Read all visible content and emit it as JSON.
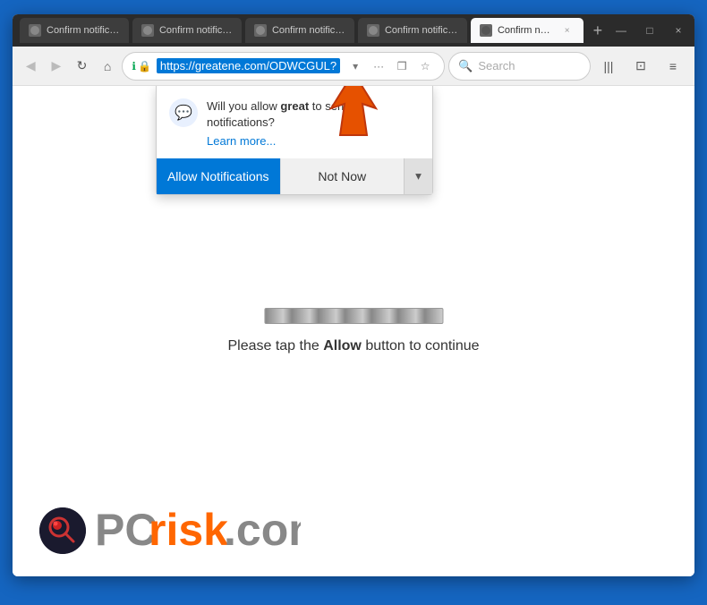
{
  "browser": {
    "tabs": [
      {
        "id": 1,
        "label": "Confirm notificatio...",
        "active": false
      },
      {
        "id": 2,
        "label": "Confirm notificatio...",
        "active": false
      },
      {
        "id": 3,
        "label": "Confirm notificatio...",
        "active": false
      },
      {
        "id": 4,
        "label": "Confirm notificatio...",
        "active": false
      },
      {
        "id": 5,
        "label": "Confirm notific...",
        "active": true
      }
    ],
    "url": "https://greatene.com/ODWCGUL?",
    "search_placeholder": "Search"
  },
  "notification_popup": {
    "message_prefix": "Will you allow ",
    "site": "great",
    "message_suffix": " to send notifications?",
    "learn_more": "Learn more...",
    "allow_label": "Allow Notifications",
    "not_now_label": "Not Now"
  },
  "page": {
    "message_prefix": "Please tap the ",
    "bold_word": "Allow",
    "message_suffix": " button to continue"
  },
  "watermark": {
    "text": "PCrisk.com",
    "domain": "pcrisk"
  },
  "icons": {
    "back": "◀",
    "forward": "▶",
    "reload": "↻",
    "home": "⌂",
    "lock": "🔒",
    "info": "ℹ",
    "more": "···",
    "pocket": "❒",
    "bookmark": "☆",
    "search": "🔍",
    "library": "|||",
    "sidebar": "⊡",
    "menu": "≡",
    "close": "×",
    "new_tab": "+",
    "minimize": "—",
    "maximize": "□",
    "chevron_down": "▾",
    "chat": "💬"
  }
}
